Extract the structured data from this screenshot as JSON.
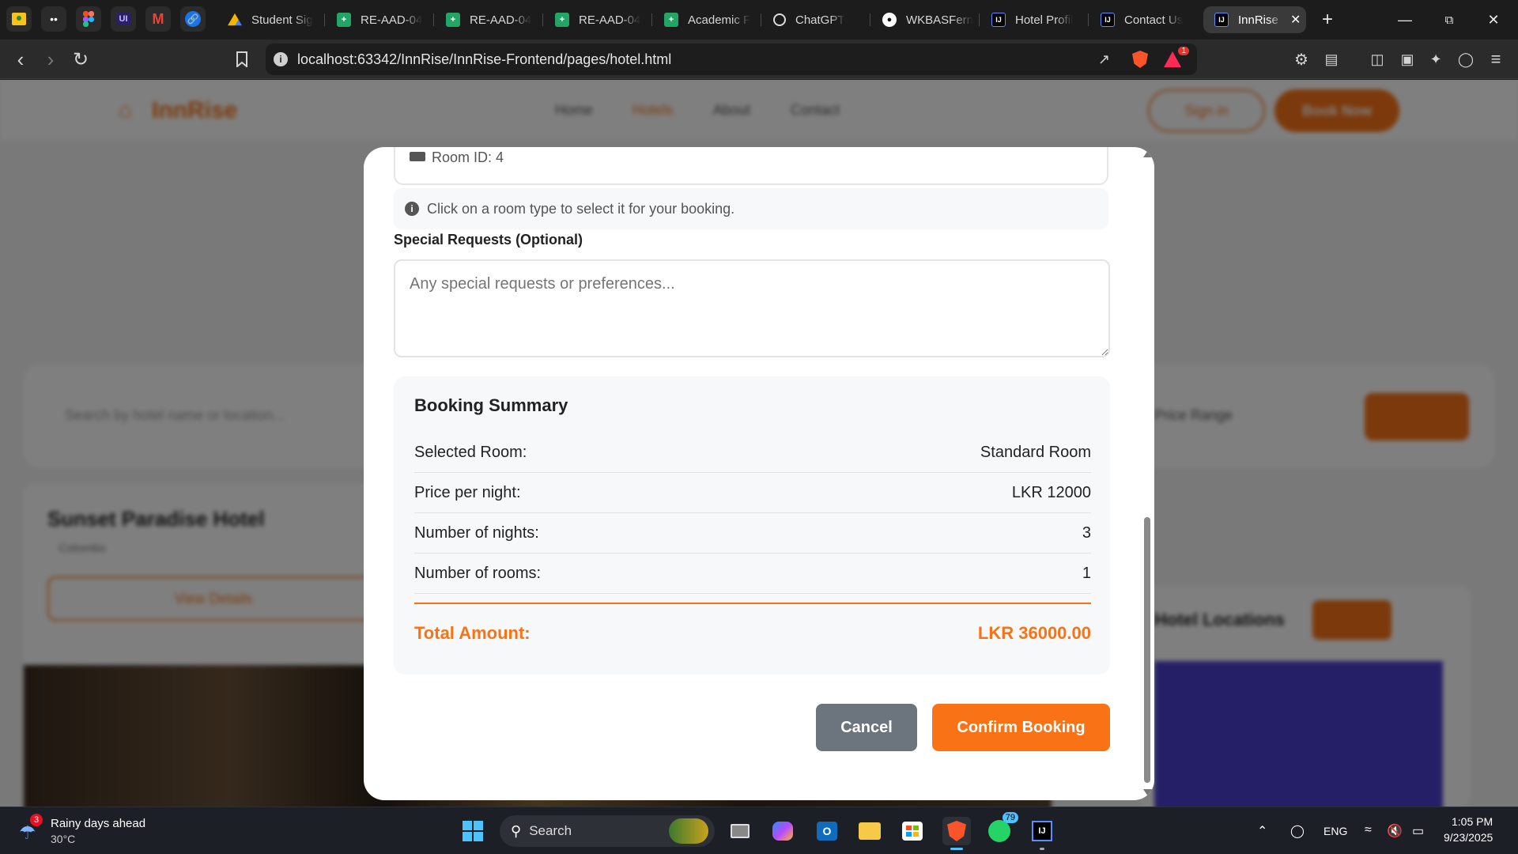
{
  "browser": {
    "tabs": [
      {
        "title": "Student Sig"
      },
      {
        "title": "RE-AAD-04"
      },
      {
        "title": "RE-AAD-04"
      },
      {
        "title": "RE-AAD-04"
      },
      {
        "title": "Academic F"
      },
      {
        "title": "ChatGPT"
      },
      {
        "title": "WKBASFern"
      },
      {
        "title": "Hotel Profil"
      },
      {
        "title": "Contact Us"
      },
      {
        "title": "InnRise"
      }
    ],
    "url": "localhost:63342/InnRise/InnRise-Frontend/pages/hotel.html",
    "brave_rewards_badge": "1"
  },
  "background_page": {
    "logo": "InnRise",
    "nav": [
      "Home",
      "Hotels",
      "About",
      "Contact"
    ],
    "sign_in": "Sign in",
    "book_now": "Book Now",
    "search_placeholder": "Search by hotel name or location...",
    "price_range": "Price Range",
    "hotel_name": "Sunset Paradise Hotel",
    "hotel_location": "Colombo",
    "view_details": "View Details",
    "locations_title": "Hotel Locations"
  },
  "modal": {
    "room_id_text": "Room ID: 4",
    "info_text": "Click on a room type to select it for your booking.",
    "special_requests_label": "Special Requests (Optional)",
    "special_requests_placeholder": "Any special requests or preferences...",
    "summary": {
      "title": "Booking Summary",
      "rows": [
        {
          "label": "Selected Room:",
          "value": "Standard Room"
        },
        {
          "label": "Price per night:",
          "value": "LKR 12000"
        },
        {
          "label": "Number of nights:",
          "value": "3"
        },
        {
          "label": "Number of rooms:",
          "value": "1"
        }
      ],
      "total_label": "Total Amount:",
      "total_value": "LKR 36000.00"
    },
    "cancel_label": "Cancel",
    "confirm_label": "Confirm Booking"
  },
  "taskbar": {
    "weather_title": "Rainy days ahead",
    "weather_temp": "30°C",
    "weather_badge": "3",
    "search_label": "Search",
    "whatsapp_badge": "79",
    "language": "ENG",
    "time": "1:05 PM",
    "date": "9/23/2025"
  },
  "colors": {
    "accent": "#f97316",
    "cancel": "#6c757d"
  }
}
